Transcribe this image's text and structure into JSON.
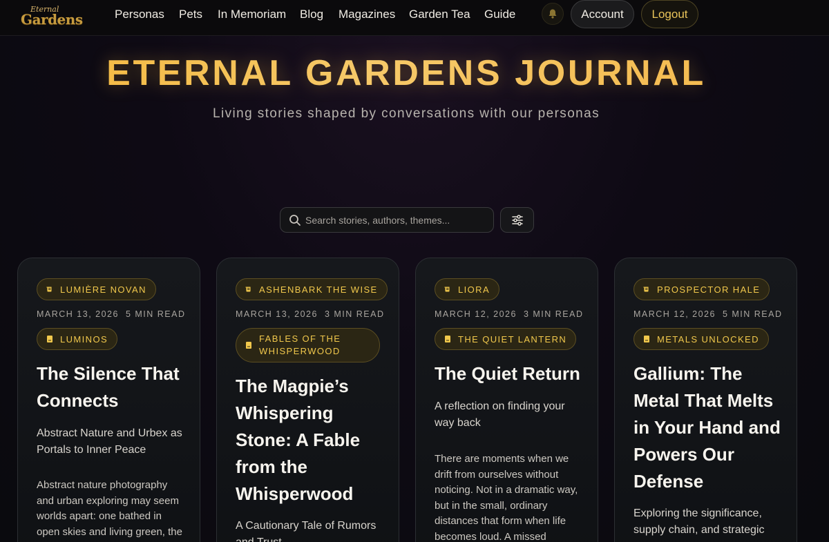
{
  "brand": {
    "logo_line1": "Eternal",
    "logo_line2": "Gardens"
  },
  "nav": {
    "items": [
      "Personas",
      "Pets",
      "In Memoriam",
      "Blog",
      "Magazines",
      "Garden Tea",
      "Guide"
    ],
    "account_label": "Account",
    "logout_label": "Logout"
  },
  "hero": {
    "title": "ETERNAL GARDENS JOURNAL",
    "subtitle": "Living stories shaped by conversations with our personas"
  },
  "search": {
    "placeholder": "Search stories, authors, themes..."
  },
  "colors": {
    "accent": "#f1c84c",
    "background": "#0e0a14",
    "card": "#16181c"
  },
  "cards": [
    {
      "author": "Lumière Novan",
      "date": "March 13, 2026",
      "read_time": "5 min read",
      "collection": "Luminos",
      "title": "The Silence That Connects",
      "subtitle": "Abstract Nature and Urbex as Portals to Inner Peace",
      "excerpt": "Abstract nature photography and urban exploring may seem worlds apart: one bathed in open skies and living green, the"
    },
    {
      "author": "Ashenbark the Wise",
      "date": "March 13, 2026",
      "read_time": "3 min read",
      "collection": "Fables of the Whisperwood",
      "title": "The Magpie’s Whispering Stone: A Fable from the Whisperwood",
      "subtitle": "A Cautionary Tale of Rumors and Trust",
      "excerpt": ""
    },
    {
      "author": "Liora",
      "date": "March 12, 2026",
      "read_time": "3 min read",
      "collection": "The Quiet Lantern",
      "title": "The Quiet Return",
      "subtitle": "A reflection on finding your way back",
      "excerpt": "There are moments when we drift from ourselves without noticing. Not in a dramatic way, but in the small, ordinary distances that form when life becomes loud. A missed"
    },
    {
      "author": "Prospector Hale",
      "date": "March 12, 2026",
      "read_time": "5 min read",
      "collection": "Metals Unlocked",
      "title": "Gallium: The Metal That Melts in Your Hand and Powers Our Defense",
      "subtitle": "Exploring the significance, supply chain, and strategic",
      "excerpt": ""
    }
  ]
}
